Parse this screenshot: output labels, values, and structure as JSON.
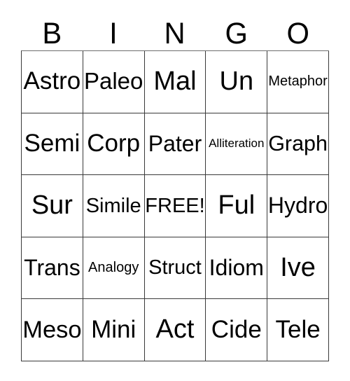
{
  "card": {
    "title": "BINGO",
    "header_letters": [
      "B",
      "I",
      "N",
      "G",
      "O"
    ],
    "colors": {
      "background": "#ffffff",
      "text": "#000000",
      "grid_line": "#3a3a3a"
    },
    "free_space": "FREE!",
    "rows": [
      [
        {
          "label": "Astro",
          "size": "lg"
        },
        {
          "label": "Paleo",
          "size": "lg"
        },
        {
          "label": "Mal",
          "size": "xl"
        },
        {
          "label": "Un",
          "size": "xl"
        },
        {
          "label": "Metaphor",
          "size": "xs"
        }
      ],
      [
        {
          "label": "Semi",
          "size": "lg"
        },
        {
          "label": "Corp",
          "size": "lg"
        },
        {
          "label": "Pater",
          "size": "md"
        },
        {
          "label": "Alliteration",
          "size": "xxs"
        },
        {
          "label": "Graph",
          "size": "md"
        }
      ],
      [
        {
          "label": "Sur",
          "size": "xl"
        },
        {
          "label": "Simile",
          "size": "sm"
        },
        {
          "label": "FREE!",
          "size": "sm"
        },
        {
          "label": "Ful",
          "size": "xl"
        },
        {
          "label": "Hydro",
          "size": "md"
        }
      ],
      [
        {
          "label": "Trans",
          "size": "md"
        },
        {
          "label": "Analogy",
          "size": "xs"
        },
        {
          "label": "Struct",
          "size": "sm"
        },
        {
          "label": "Idiom",
          "size": "md"
        },
        {
          "label": "Ive",
          "size": "xl"
        }
      ],
      [
        {
          "label": "Meso",
          "size": "lg"
        },
        {
          "label": "Mini",
          "size": "lg"
        },
        {
          "label": "Act",
          "size": "xl"
        },
        {
          "label": "Cide",
          "size": "lg"
        },
        {
          "label": "Tele",
          "size": "lg"
        }
      ]
    ]
  }
}
